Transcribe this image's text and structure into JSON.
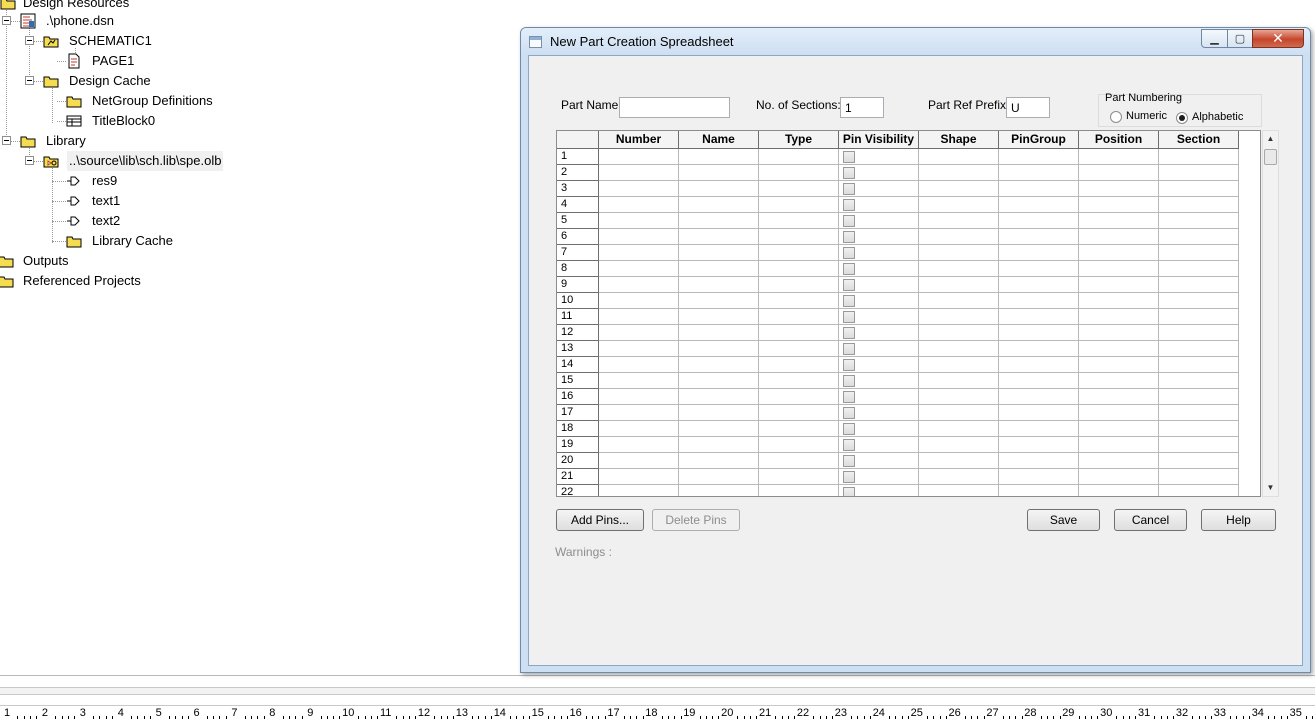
{
  "tree": {
    "nodes": [
      {
        "label": "Design Resources",
        "icon": "folder-icon"
      },
      {
        "label": ".\\phone.dsn",
        "icon": "design-file-icon"
      },
      {
        "label": "SCHEMATIC1",
        "icon": "schematic-folder-icon"
      },
      {
        "label": "PAGE1",
        "icon": "page-icon"
      },
      {
        "label": "Design Cache",
        "icon": "folder-icon"
      },
      {
        "label": "NetGroup Definitions",
        "icon": "folder-icon"
      },
      {
        "label": "TitleBlock0",
        "icon": "titleblock-icon"
      },
      {
        "label": "Library",
        "icon": "folder-icon"
      },
      {
        "label": "..\\source\\lib\\sch.lib\\spe.olb",
        "icon": "library-file-icon"
      },
      {
        "label": "res9",
        "icon": "part-icon"
      },
      {
        "label": "text1",
        "icon": "part-icon"
      },
      {
        "label": "text2",
        "icon": "part-icon"
      },
      {
        "label": "Library Cache",
        "icon": "folder-icon"
      },
      {
        "label": "Outputs",
        "icon": "folder-icon"
      },
      {
        "label": "Referenced Projects",
        "icon": "folder-icon"
      }
    ]
  },
  "ruler": {
    "numbers": [
      "1",
      "2",
      "3",
      "4",
      "5",
      "6",
      "7",
      "8",
      "9",
      "10",
      "11",
      "12",
      "13",
      "14",
      "15",
      "16",
      "17",
      "18",
      "19",
      "20",
      "21",
      "22",
      "23",
      "24",
      "25",
      "26",
      "27",
      "28",
      "29",
      "30",
      "31",
      "32",
      "33",
      "34",
      "35"
    ]
  },
  "dialog": {
    "title": "New Part Creation Spreadsheet",
    "part_name_label": "Part Name:",
    "part_name_value": "",
    "sections_label": "No. of Sections:",
    "sections_value": "1",
    "ref_prefix_label": "Part Ref Prefix:",
    "ref_prefix_value": "U",
    "numbering": {
      "group_label": "Part Numbering",
      "numeric_label": "Numeric",
      "alphabetic_label": "Alphabetic",
      "selected": "Alphabetic"
    },
    "columns": [
      "Number",
      "Name",
      "Type",
      "Pin Visibility",
      "Shape",
      "PinGroup",
      "Position",
      "Section"
    ],
    "rows": [
      "1",
      "2",
      "3",
      "4",
      "5",
      "6",
      "7",
      "8",
      "9",
      "10",
      "11",
      "12",
      "13",
      "14",
      "15",
      "16",
      "17",
      "18",
      "19",
      "20",
      "21",
      "22"
    ],
    "buttons": {
      "add_pins": "Add Pins...",
      "delete_pins": "Delete Pins",
      "save": "Save",
      "cancel": "Cancel",
      "help": "Help"
    },
    "warnings_label": "Warnings :"
  }
}
